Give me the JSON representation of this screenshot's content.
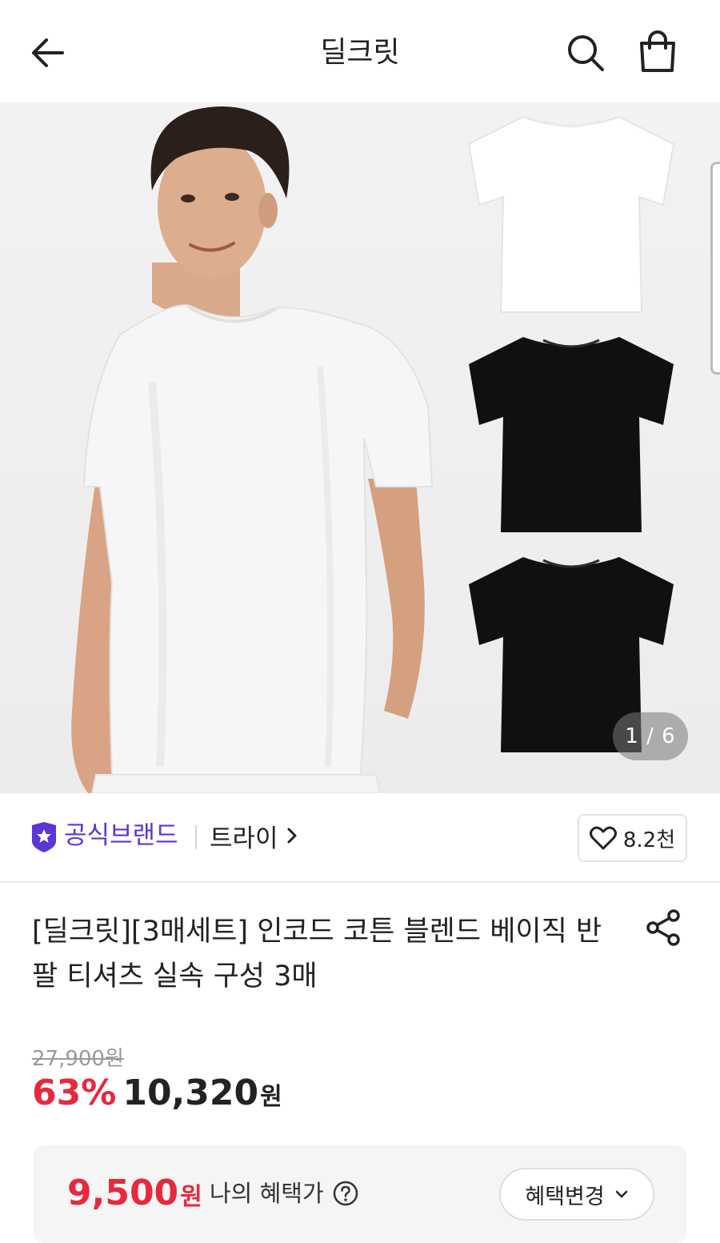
{
  "header": {
    "title": "딜크릿",
    "back_icon": "arrow-left-icon",
    "search_icon": "search-icon",
    "cart_icon": "shopping-bag-icon"
  },
  "gallery": {
    "current": "1",
    "separator": "/",
    "total": "6",
    "indicator_text": "1 / 6"
  },
  "brand": {
    "official_label": "공식브랜드",
    "official_icon": "shield-star-icon",
    "name": "트라이",
    "chevron_icon": "chevron-right-icon",
    "accent_color": "#5b35d5"
  },
  "like": {
    "icon": "heart-icon",
    "count": "8.2천"
  },
  "product": {
    "title": "[딜크릿][3매세트] 인코드 코튼 블렌드 베이직 반팔 티셔츠 실속 구성 3매",
    "share_icon": "share-icon"
  },
  "pricing": {
    "original_price": "27,900원",
    "discount_rate": "63%",
    "sale_price": "10,320",
    "currency": "원",
    "sale_color": "#e8283d"
  },
  "benefit": {
    "price": "9,500",
    "currency": "원",
    "label": "나의 혜택가",
    "help_icon": "question-circle-icon",
    "change_button": "혜택변경",
    "change_icon": "chevron-down-icon"
  }
}
